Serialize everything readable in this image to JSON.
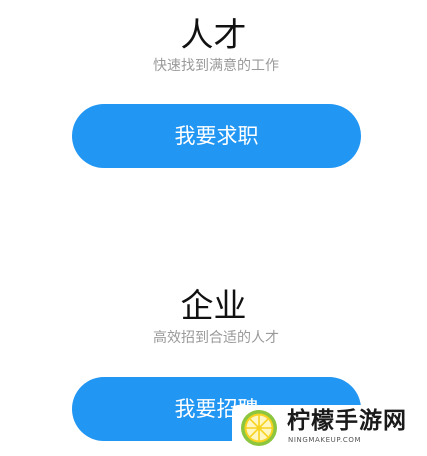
{
  "talent": {
    "title": "人才",
    "subtitle": "快速找到满意的工作",
    "button_label": "我要求职"
  },
  "company": {
    "title": "企业",
    "subtitle": "高效招到合适的人才",
    "button_label": "我要招聘"
  },
  "watermark": {
    "name": "柠檬手游网",
    "url": "NINGMAKEUP.COM"
  },
  "colors": {
    "accent": "#2196f3",
    "subtitle": "#9a9a9a",
    "title": "#111111"
  }
}
